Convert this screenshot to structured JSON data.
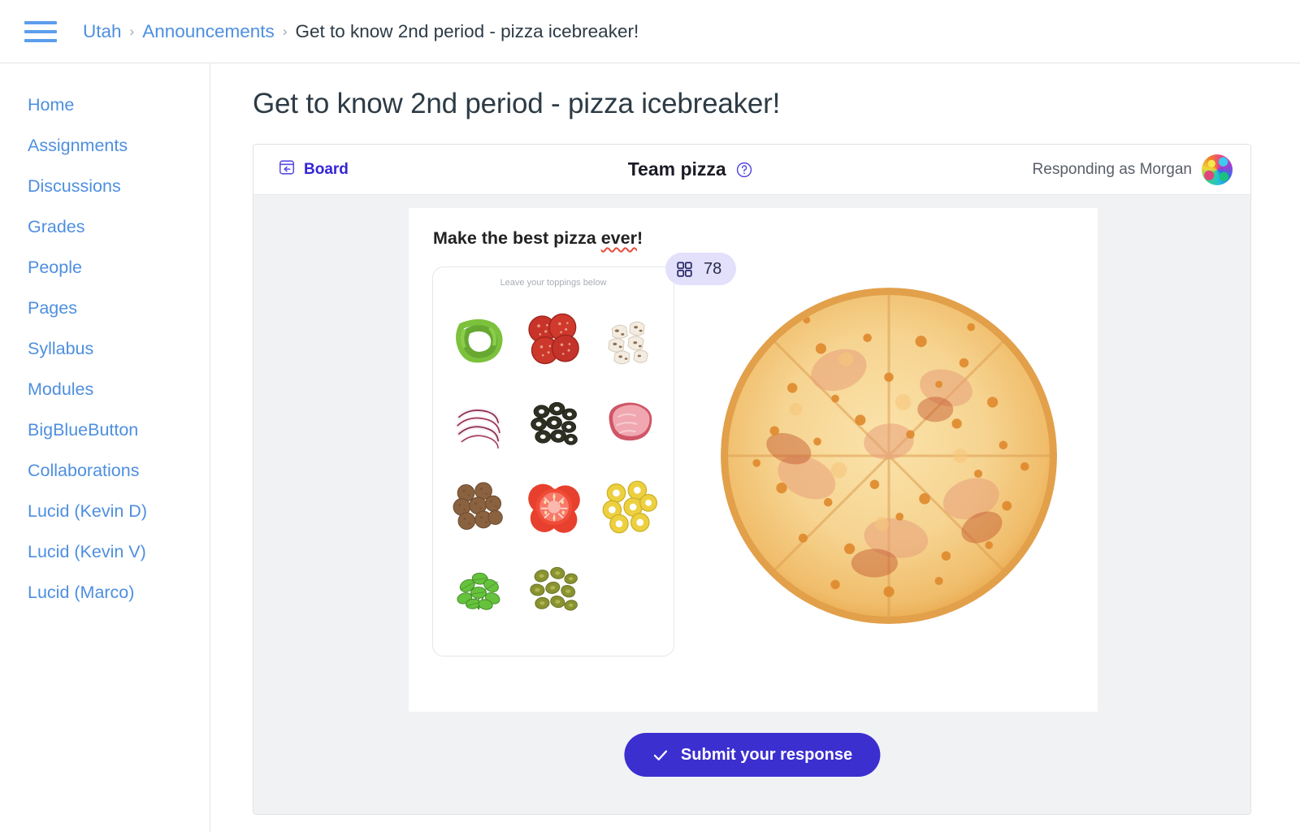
{
  "topbar": {
    "menu_icon": "hamburger-menu-icon",
    "breadcrumb": {
      "items": [
        {
          "label": "Utah",
          "type": "link"
        },
        {
          "label": "Announcements",
          "type": "link"
        },
        {
          "label": "Get to know 2nd period - pizza icebreaker!",
          "type": "current"
        }
      ],
      "separator": "›"
    }
  },
  "sidebar": {
    "items": [
      {
        "label": "Home"
      },
      {
        "label": "Assignments"
      },
      {
        "label": "Discussions"
      },
      {
        "label": "Grades"
      },
      {
        "label": "People"
      },
      {
        "label": "Pages"
      },
      {
        "label": "Syllabus"
      },
      {
        "label": "Modules"
      },
      {
        "label": "BigBlueButton"
      },
      {
        "label": "Collaborations"
      },
      {
        "label": "Lucid (Kevin D)"
      },
      {
        "label": "Lucid (Kevin V)"
      },
      {
        "label": "Lucid (Marco)"
      }
    ]
  },
  "main": {
    "page_title": "Get to know 2nd period - pizza icebreaker!"
  },
  "app": {
    "toolbar": {
      "back_label": "Board",
      "back_icon": "board-back-icon",
      "board_title": "Team pizza",
      "help_icon": "help-circle-icon",
      "responding_as": "Responding as Morgan",
      "avatar_icon": "user-avatar"
    },
    "slide": {
      "heading_prefix": "Make the best pizza ",
      "heading_misspelled": "ever",
      "heading_suffix": "!",
      "panel_caption": "Leave your toppings below",
      "count_badge": {
        "icon": "grid-icon",
        "value": "78"
      },
      "toppings": [
        {
          "name": "green-pepper"
        },
        {
          "name": "pepperoni"
        },
        {
          "name": "mushrooms"
        },
        {
          "name": "red-onion"
        },
        {
          "name": "black-olives"
        },
        {
          "name": "ham"
        },
        {
          "name": "meatballs"
        },
        {
          "name": "tomato"
        },
        {
          "name": "banana-peppers"
        },
        {
          "name": "basil"
        },
        {
          "name": "jalapenos"
        }
      ],
      "pizza_image_alt": "cheese-pizza"
    },
    "submit": {
      "label": "Submit your response",
      "icon": "check-icon"
    }
  },
  "colors": {
    "link_blue": "#4e8fe0",
    "title_slate": "#2d3b45",
    "brand_indigo": "#3425d6",
    "submit_violet": "#3b2fd0",
    "badge_lavender": "#e2e0fb",
    "canvas_gray": "#f1f2f4",
    "spellcheck_red": "#ea4b3c"
  }
}
